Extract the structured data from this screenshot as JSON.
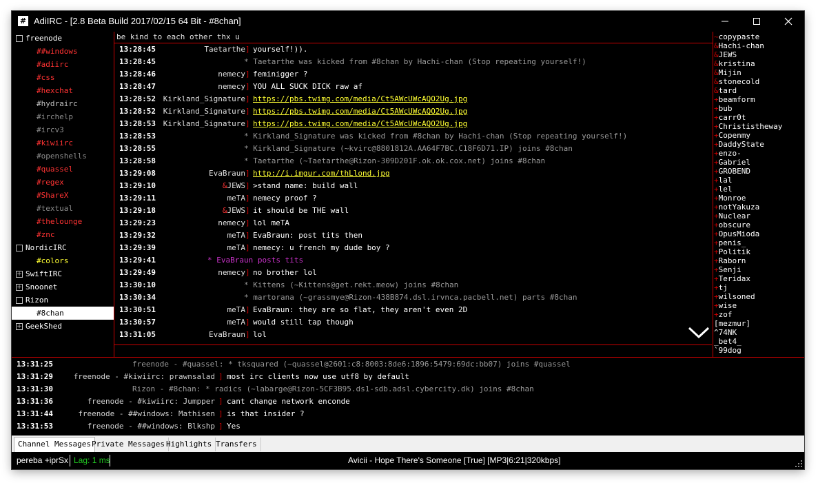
{
  "app": {
    "icon_glyph": "#",
    "title": "AdiIRC - [2.8 Beta Build 2017/02/15 64 Bit - #8chan]"
  },
  "colors": {
    "accent_red": "#cc0000",
    "link_yellow": "#ffff33",
    "action_purple": "#cc33cc",
    "lag_green": "#22cc22",
    "event_gray": "#9a9a9a"
  },
  "tree": {
    "networks": [
      {
        "name": "freenode",
        "expanded": true,
        "channels": [
          {
            "name": "##windows",
            "color": "#ff3333"
          },
          {
            "name": "#adiirc",
            "color": "#ff3333"
          },
          {
            "name": "#css",
            "color": "#ff3333"
          },
          {
            "name": "#hexchat",
            "color": "#ff3333"
          },
          {
            "name": "#hydrairc",
            "color": "#c0c0c0"
          },
          {
            "name": "#irchelp",
            "color": "#8a8a8a"
          },
          {
            "name": "#ircv3",
            "color": "#8a8a8a"
          },
          {
            "name": "#kiwiirc",
            "color": "#ff3333"
          },
          {
            "name": "#openshells",
            "color": "#8a8a8a"
          },
          {
            "name": "#quassel",
            "color": "#ff3333"
          },
          {
            "name": "#regex",
            "color": "#ff3333"
          },
          {
            "name": "#ShareX",
            "color": "#ff3333"
          },
          {
            "name": "#textual",
            "color": "#8a8a8a"
          },
          {
            "name": "#thelounge",
            "color": "#ff3333"
          },
          {
            "name": "#znc",
            "color": "#ff3333"
          }
        ]
      },
      {
        "name": "NordicIRC",
        "expanded": true,
        "channels": [
          {
            "name": "#colors",
            "color": "#ffff33"
          }
        ]
      },
      {
        "name": "SwiftIRC",
        "expanded": false,
        "channels": []
      },
      {
        "name": "Snoonet",
        "expanded": false,
        "channels": []
      },
      {
        "name": "Rizon",
        "expanded": true,
        "channels": [
          {
            "name": "#8chan",
            "color": "#000000",
            "selected": true
          }
        ]
      },
      {
        "name": "GeekShed",
        "expanded": false,
        "channels": []
      }
    ]
  },
  "topic": "be kind to each other thx u",
  "messages": [
    {
      "ts": "13:28:45",
      "kind": "msg",
      "nick": "Taetarthe",
      "nick_color": "#e0e0e0",
      "text": "yourself!))."
    },
    {
      "ts": "13:28:45",
      "kind": "event",
      "text": "* Taetarthe was kicked from #8chan by Hachi-chan (Stop repeating yourself!)"
    },
    {
      "ts": "13:28:46",
      "kind": "msg",
      "nick": "nemecy",
      "nick_color": "#e0e0e0",
      "text": "feminigger ?"
    },
    {
      "ts": "13:28:47",
      "kind": "msg",
      "nick": "nemecy",
      "nick_color": "#e0e0e0",
      "text": "YOU ALL SUCK DICK raw af"
    },
    {
      "ts": "13:28:52",
      "kind": "link",
      "nick": "Kirkland_Signature",
      "nick_color": "#e0e0e0",
      "text": "https://pbs.twimg.com/media/Ct5AWcUWcAQO2Ug.jpg"
    },
    {
      "ts": "13:28:52",
      "kind": "link",
      "nick": "Kirkland_Signature",
      "nick_color": "#e0e0e0",
      "text": "https://pbs.twimg.com/media/Ct5AWcUWcAQO2Ug.jpg"
    },
    {
      "ts": "13:28:53",
      "kind": "link",
      "nick": "Kirkland_Signature",
      "nick_color": "#e0e0e0",
      "text": "https://pbs.twimg.com/media/Ct5AWcUWcAQO2Ug.jpg"
    },
    {
      "ts": "13:28:53",
      "kind": "event",
      "text": "* Kirkland_Signature was kicked from #8chan by Hachi-chan (Stop repeating yourself!)"
    },
    {
      "ts": "13:28:55",
      "kind": "event",
      "text": "* Kirkland_Signature (~kvirc@8801812A.AA64F7BC.C18F6D71.IP) joins #8chan"
    },
    {
      "ts": "13:28:58",
      "kind": "event",
      "text": "* Taetarthe (~Taetarthe@Rizon-309D201F.ok.ok.cox.net) joins #8chan"
    },
    {
      "ts": "13:29:08",
      "kind": "link",
      "nick": "EvaBraun",
      "nick_color": "#e0e0e0",
      "text": "http://i.imgur.com/thLlond.jpg"
    },
    {
      "ts": "13:29:10",
      "kind": "msg",
      "nick": "&JEWS",
      "nick_color": "#e0e0e0",
      "text": ">stand name: build wall"
    },
    {
      "ts": "13:29:11",
      "kind": "msg",
      "nick": "meTA",
      "nick_color": "#e0e0e0",
      "text": "nemecy proof ?"
    },
    {
      "ts": "13:29:18",
      "kind": "msg",
      "nick": "&JEWS",
      "nick_color": "#e0e0e0",
      "text": "it should be THE wall"
    },
    {
      "ts": "13:29:23",
      "kind": "msg",
      "nick": "nemecy",
      "nick_color": "#e0e0e0",
      "text": "lol meTA"
    },
    {
      "ts": "13:29:32",
      "kind": "msg",
      "nick": "meTA",
      "nick_color": "#e0e0e0",
      "text": "EvaBraun: post tits then"
    },
    {
      "ts": "13:29:39",
      "kind": "msg",
      "nick": "meTA",
      "nick_color": "#e0e0e0",
      "text": "nemecy:  u french my dude boy ?"
    },
    {
      "ts": "13:29:41",
      "kind": "action",
      "text": "* EvaBraun posts tits"
    },
    {
      "ts": "13:29:49",
      "kind": "msg",
      "nick": "nemecy",
      "nick_color": "#e0e0e0",
      "text": "no brother lol"
    },
    {
      "ts": "13:30:10",
      "kind": "event",
      "text": "* Kittens (~Kittens@get.rekt.meow) joins #8chan"
    },
    {
      "ts": "13:30:34",
      "kind": "event",
      "text": "* martorana (~grassmye@Rizon-438B874.dsl.irvnca.pacbell.net) parts #8chan"
    },
    {
      "ts": "13:30:51",
      "kind": "msg",
      "nick": "meTA",
      "nick_color": "#e0e0e0",
      "text": "EvaBraun:  they are so flat, they aren't even 2D"
    },
    {
      "ts": "13:30:57",
      "kind": "msg",
      "nick": "meTA",
      "nick_color": "#e0e0e0",
      "text": "would still tap though"
    },
    {
      "ts": "13:31:05",
      "kind": "msg",
      "nick": "EvaBraun",
      "nick_color": "#e0e0e0",
      "text": "lol"
    }
  ],
  "nicklist": [
    {
      "prefix": "~",
      "name": "copypaste"
    },
    {
      "prefix": "&",
      "name": "Hachi-chan"
    },
    {
      "prefix": "&",
      "name": "JEWS"
    },
    {
      "prefix": "&",
      "name": "kristina"
    },
    {
      "prefix": "&",
      "name": "Mijin"
    },
    {
      "prefix": "&",
      "name": "stonecold"
    },
    {
      "prefix": "&",
      "name": "tard"
    },
    {
      "prefix": "+",
      "name": "beamform"
    },
    {
      "prefix": "+",
      "name": "bub"
    },
    {
      "prefix": "+",
      "name": "carr0t"
    },
    {
      "prefix": "+",
      "name": "Christistheway"
    },
    {
      "prefix": "+",
      "name": "Copenmy"
    },
    {
      "prefix": "+",
      "name": "DaddyState"
    },
    {
      "prefix": "+",
      "name": "enzo-"
    },
    {
      "prefix": "+",
      "name": "Gabriel"
    },
    {
      "prefix": "+",
      "name": "GROBEND"
    },
    {
      "prefix": "+",
      "name": "lal"
    },
    {
      "prefix": "+",
      "name": "lel"
    },
    {
      "prefix": "+",
      "name": "Monroe"
    },
    {
      "prefix": "+",
      "name": "notYakuza"
    },
    {
      "prefix": "+",
      "name": "Nuclear"
    },
    {
      "prefix": "+",
      "name": "obscure"
    },
    {
      "prefix": "+",
      "name": "OpusMioda"
    },
    {
      "prefix": "+",
      "name": "penis_"
    },
    {
      "prefix": "+",
      "name": "Politik"
    },
    {
      "prefix": "+",
      "name": "Raborn"
    },
    {
      "prefix": "+",
      "name": "Senji"
    },
    {
      "prefix": "+",
      "name": "Teridax"
    },
    {
      "prefix": "+",
      "name": "tj"
    },
    {
      "prefix": "+",
      "name": "wilsoned"
    },
    {
      "prefix": "+",
      "name": "wise"
    },
    {
      "prefix": "+",
      "name": "zof"
    },
    {
      "prefix": "",
      "name": "[mezmur]"
    },
    {
      "prefix": "",
      "name": "^74NK"
    },
    {
      "prefix": "",
      "name": "_bet4_"
    },
    {
      "prefix": "",
      "name": "`99dog"
    }
  ],
  "monitor": [
    {
      "ts": "13:31:25",
      "kind": "event",
      "text": "freenode - #quassel: * tksquared (~quassel@2601:c8:8003:8de6:1896:5479:69dc:bb07) joins #quassel"
    },
    {
      "ts": "13:31:29",
      "kind": "msg",
      "src": "freenode - #kiwiirc: prawnsalad",
      "text": "most irc clients now use utf8 by default"
    },
    {
      "ts": "13:31:30",
      "kind": "event",
      "text": "Rizon - #8chan: * radics (~labarge@Rizon-5CF3B95.ds1-sdb.adsl.cybercity.dk) joins #8chan"
    },
    {
      "ts": "13:31:36",
      "kind": "msg",
      "src": "freenode - #kiwiirc: Jumpper",
      "text": " cant change network enconde"
    },
    {
      "ts": "13:31:44",
      "kind": "msg",
      "src": "freenode - ##windows: Mathisen",
      "text": "is that insider ?"
    },
    {
      "ts": "13:31:53",
      "kind": "msg",
      "src": "freenode - ##windows: Blkshp",
      "text": " Yes"
    }
  ],
  "tabs": [
    {
      "label": "Channel Messages",
      "active": true
    },
    {
      "label": "Private Messages",
      "active": false
    },
    {
      "label": "Highlights",
      "active": false
    },
    {
      "label": "Transfers",
      "active": false
    }
  ],
  "status": {
    "nick_modes": "pereba +iprSx",
    "lag": "Lag: 1 ms",
    "now_playing": "Avicii - Hope There's Someone [True] [MP3|6:21|320kbps]"
  }
}
